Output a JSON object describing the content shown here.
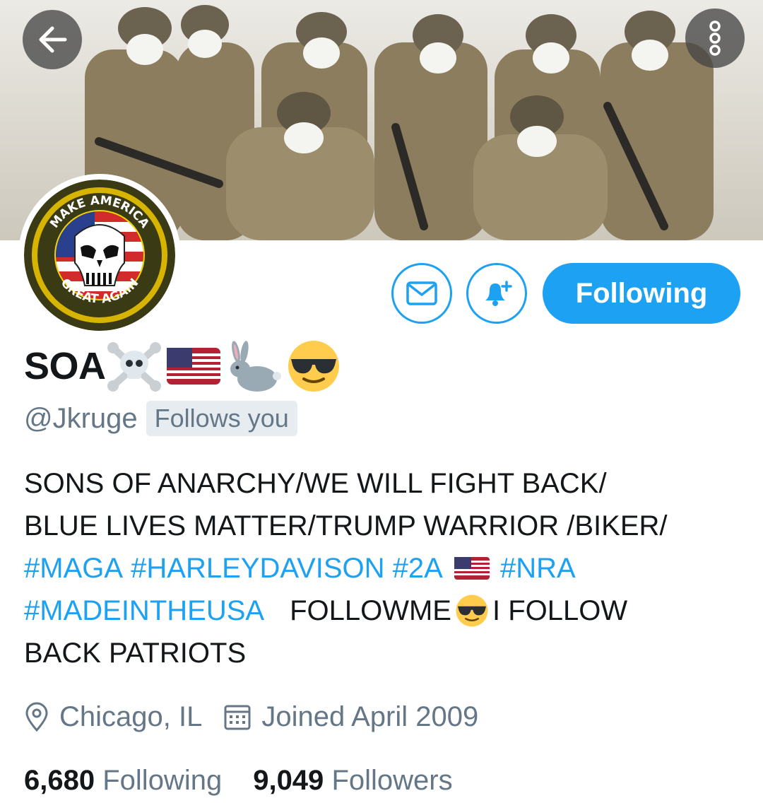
{
  "header": {
    "back_icon": "arrow-left-icon",
    "more_icon": "more-vertical-icon"
  },
  "banner": {
    "description_colors": {
      "sky": "#dedcd6",
      "gear": "#8c7d5e"
    }
  },
  "avatar": {
    "ring_text_top": "MAKE AMERICA",
    "ring_text_bottom": "GREAT AGAIN",
    "colors": {
      "ring": "#d6b400",
      "outer": "#3a3a14"
    }
  },
  "actions": {
    "message_icon": "envelope-icon",
    "notify_icon": "bell-plus-icon",
    "following_label": "Following"
  },
  "profile": {
    "display_name": "SOA",
    "name_emojis": [
      "skull-crossbones-icon",
      "us-flag-icon",
      "rabbit-icon",
      "sunglasses-face-icon"
    ],
    "handle": "@Jkruge",
    "follows_you": "Follows you"
  },
  "bio": {
    "line1": "SONS OF ANARCHY/WE WILL FIGHT BACK/",
    "line2": "BLUE LIVES MATTER/TRUMP WARRIOR /BIKER/",
    "line3_tags": [
      "#MAGA",
      "#HARLEYDAVISON",
      "#2A"
    ],
    "line3_tag_after_flag": "#NRA",
    "line4_tag": "#MADEINTHEUSA",
    "line4_text_a": "FOLLOWME",
    "line4_text_b": "I FOLLOW",
    "line5": "BACK PATRIOTS"
  },
  "meta": {
    "location_icon": "map-pin-icon",
    "location": "Chicago, IL",
    "calendar_icon": "calendar-icon",
    "joined": "Joined April 2009"
  },
  "stats": {
    "following_count": "6,680",
    "following_label": "Following",
    "followers_count": "9,049",
    "followers_label": "Followers"
  },
  "colors": {
    "accent": "#1da1f2",
    "secondary_text": "#657786",
    "primary_text": "#14171a",
    "badge_bg": "#e6ecf0"
  }
}
